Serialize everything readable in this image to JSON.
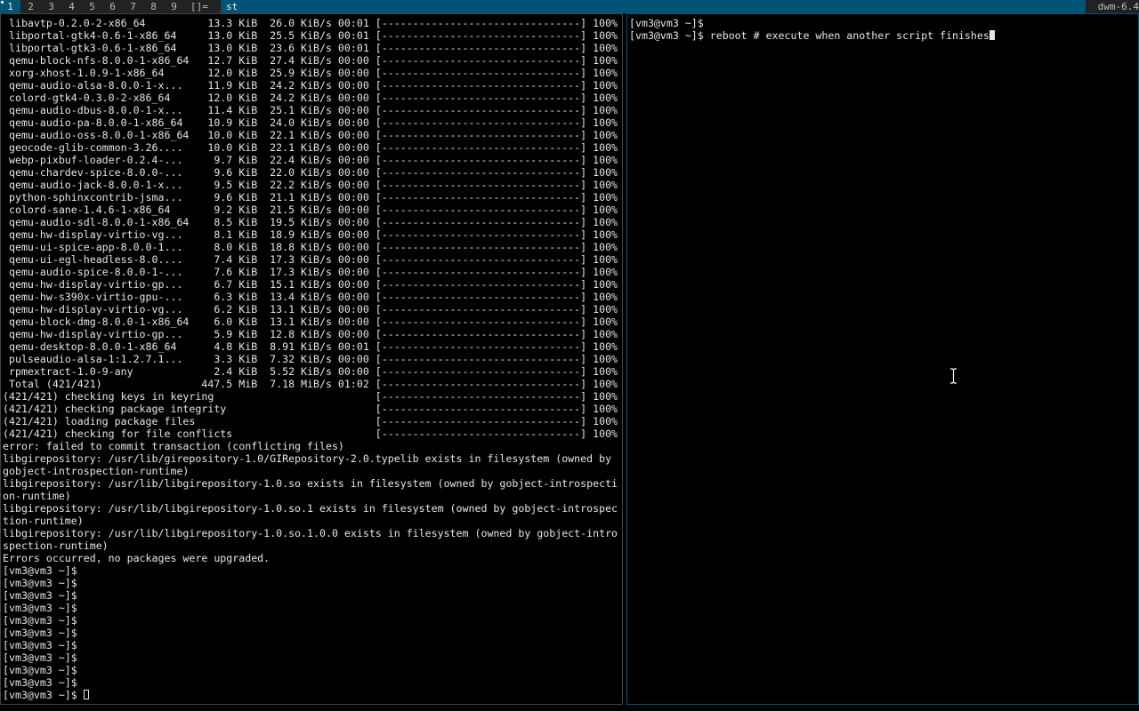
{
  "bar": {
    "tags": [
      {
        "label": "1",
        "selected": true,
        "occupied": true
      },
      {
        "label": "2",
        "selected": false,
        "occupied": false
      },
      {
        "label": "3",
        "selected": false,
        "occupied": false
      },
      {
        "label": "4",
        "selected": false,
        "occupied": false
      },
      {
        "label": "5",
        "selected": false,
        "occupied": false
      },
      {
        "label": "6",
        "selected": false,
        "occupied": false
      },
      {
        "label": "7",
        "selected": false,
        "occupied": false
      },
      {
        "label": "8",
        "selected": false,
        "occupied": false
      },
      {
        "label": "9",
        "selected": false,
        "occupied": false
      }
    ],
    "layout_symbol": "[]=",
    "window_title": "st",
    "status_text": "dwm-6.4"
  },
  "left_terminal": {
    "lines": [
      " libavtp-0.2.0-2-x86_64          13.3 KiB  26.0 KiB/s 00:01 [--------------------------------] 100%",
      " libportal-gtk4-0.6-1-x86_64     13.0 KiB  25.5 KiB/s 00:01 [--------------------------------] 100%",
      " libportal-gtk3-0.6-1-x86_64     13.0 KiB  23.6 KiB/s 00:01 [--------------------------------] 100%",
      " qemu-block-nfs-8.0.0-1-x86_64   12.7 KiB  27.4 KiB/s 00:00 [--------------------------------] 100%",
      " xorg-xhost-1.0.9-1-x86_64       12.0 KiB  25.9 KiB/s 00:00 [--------------------------------] 100%",
      " qemu-audio-alsa-8.0.0-1-x...    11.9 KiB  24.2 KiB/s 00:00 [--------------------------------] 100%",
      " colord-gtk4-0.3.0-2-x86_64      12.0 KiB  24.2 KiB/s 00:00 [--------------------------------] 100%",
      " qemu-audio-dbus-8.0.0-1-x...    11.4 KiB  25.1 KiB/s 00:00 [--------------------------------] 100%",
      " qemu-audio-pa-8.0.0-1-x86_64    10.9 KiB  24.0 KiB/s 00:00 [--------------------------------] 100%",
      " qemu-audio-oss-8.0.0-1-x86_64   10.0 KiB  22.1 KiB/s 00:00 [--------------------------------] 100%",
      " geocode-glib-common-3.26....    10.0 KiB  22.1 KiB/s 00:00 [--------------------------------] 100%",
      " webp-pixbuf-loader-0.2.4-...     9.7 KiB  22.4 KiB/s 00:00 [--------------------------------] 100%",
      " qemu-chardev-spice-8.0.0-...     9.6 KiB  22.0 KiB/s 00:00 [--------------------------------] 100%",
      " qemu-audio-jack-8.0.0-1-x...     9.5 KiB  22.2 KiB/s 00:00 [--------------------------------] 100%",
      " python-sphinxcontrib-jsma...     9.6 KiB  21.1 KiB/s 00:00 [--------------------------------] 100%",
      " colord-sane-1.4.6-1-x86_64       9.2 KiB  21.5 KiB/s 00:00 [--------------------------------] 100%",
      " qemu-audio-sdl-8.0.0-1-x86_64    8.5 KiB  19.5 KiB/s 00:00 [--------------------------------] 100%",
      " qemu-hw-display-virtio-vg...     8.1 KiB  18.9 KiB/s 00:00 [--------------------------------] 100%",
      " qemu-ui-spice-app-8.0.0-1...     8.0 KiB  18.8 KiB/s 00:00 [--------------------------------] 100%",
      " qemu-ui-egl-headless-8.0....     7.4 KiB  17.3 KiB/s 00:00 [--------------------------------] 100%",
      " qemu-audio-spice-8.0.0-1-...     7.6 KiB  17.3 KiB/s 00:00 [--------------------------------] 100%",
      " qemu-hw-display-virtio-gp...     6.7 KiB  15.1 KiB/s 00:00 [--------------------------------] 100%",
      " qemu-hw-s390x-virtio-gpu-...     6.3 KiB  13.4 KiB/s 00:00 [--------------------------------] 100%",
      " qemu-hw-display-virtio-vg...     6.2 KiB  13.1 KiB/s 00:00 [--------------------------------] 100%",
      " qemu-block-dmg-8.0.0-1-x86_64    6.0 KiB  13.1 KiB/s 00:00 [--------------------------------] 100%",
      " qemu-hw-display-virtio-gp...     5.9 KiB  12.8 KiB/s 00:00 [--------------------------------] 100%",
      " qemu-desktop-8.0.0-1-x86_64      4.8 KiB  8.91 KiB/s 00:01 [--------------------------------] 100%",
      " pulseaudio-alsa-1:1.2.7.1...     3.3 KiB  7.32 KiB/s 00:00 [--------------------------------] 100%",
      " rpmextract-1.0-9-any             2.4 KiB  5.52 KiB/s 00:00 [--------------------------------] 100%",
      " Total (421/421)                447.5 MiB  7.18 MiB/s 01:02 [--------------------------------] 100%",
      "(421/421) checking keys in keyring                          [--------------------------------] 100%",
      "(421/421) checking package integrity                        [--------------------------------] 100%",
      "(421/421) loading package files                             [--------------------------------] 100%",
      "(421/421) checking for file conflicts                       [--------------------------------] 100%",
      "error: failed to commit transaction (conflicting files)",
      "libgirepository: /usr/lib/girepository-1.0/GIRepository-2.0.typelib exists in filesystem (owned by",
      "gobject-introspection-runtime)",
      "libgirepository: /usr/lib/libgirepository-1.0.so exists in filesystem (owned by gobject-introspecti",
      "on-runtime)",
      "libgirepository: /usr/lib/libgirepository-1.0.so.1 exists in filesystem (owned by gobject-introspec",
      "tion-runtime)",
      "libgirepository: /usr/lib/libgirepository-1.0.so.1.0.0 exists in filesystem (owned by gobject-intro",
      "spection-runtime)",
      "Errors occurred, no packages were upgraded.",
      "[vm3@vm3 ~]$",
      "[vm3@vm3 ~]$",
      "[vm3@vm3 ~]$",
      "[vm3@vm3 ~]$",
      "[vm3@vm3 ~]$",
      "[vm3@vm3 ~]$",
      "[vm3@vm3 ~]$",
      "[vm3@vm3 ~]$",
      "[vm3@vm3 ~]$",
      "[vm3@vm3 ~]$"
    ],
    "prompt": "[vm3@vm3 ~]$ "
  },
  "right_terminal": {
    "lines": [
      "[vm3@vm3 ~]$"
    ],
    "prompt": "[vm3@vm3 ~]$ ",
    "input_value": "reboot # execute when another script finishes"
  },
  "colors": {
    "bar_bg": "#222222",
    "accent": "#005577",
    "text": "#e5e5e5",
    "border_inactive": "#444444"
  }
}
